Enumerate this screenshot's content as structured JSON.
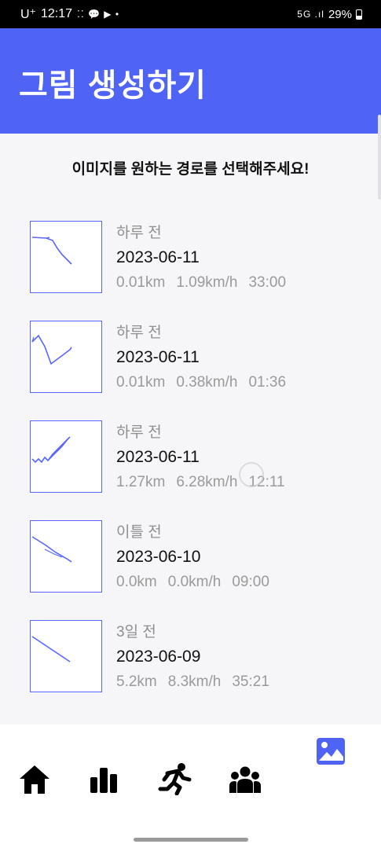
{
  "status_bar": {
    "carrier": "U⁺",
    "time": "12:17",
    "notification_icons": "⁚⁚ 💬 ▶ •",
    "signal": "5G .ıl",
    "battery": "29%"
  },
  "header": {
    "title": "그림 생성하기"
  },
  "subtitle": "이미지를 원하는 경로를 선택해주세요!",
  "routes": [
    {
      "ago": "하루 전",
      "date": "2023-06-11",
      "distance": "0.01km",
      "speed": "1.09km/h",
      "duration": "33:00"
    },
    {
      "ago": "하루 전",
      "date": "2023-06-11",
      "distance": "0.01km",
      "speed": "0.38km/h",
      "duration": "01:36"
    },
    {
      "ago": "하루 전",
      "date": "2023-06-11",
      "distance": "1.27km",
      "speed": "6.28km/h",
      "duration": "12:11"
    },
    {
      "ago": "이틀 전",
      "date": "2023-06-10",
      "distance": "0.0km",
      "speed": "0.0km/h",
      "duration": "09:00"
    },
    {
      "ago": "3일 전",
      "date": "2023-06-09",
      "distance": "5.2km",
      "speed": "8.3km/h",
      "duration": "35:21"
    }
  ],
  "bottom_nav": {
    "items": [
      {
        "icon": "home-icon"
      },
      {
        "icon": "bar-chart-icon"
      },
      {
        "icon": "running-icon"
      },
      {
        "icon": "group-icon"
      },
      {
        "icon": "image-icon",
        "active": true
      }
    ]
  },
  "colors": {
    "primary": "#4f63f5",
    "route_line": "#5866ff",
    "background": "#f6f6f8"
  }
}
